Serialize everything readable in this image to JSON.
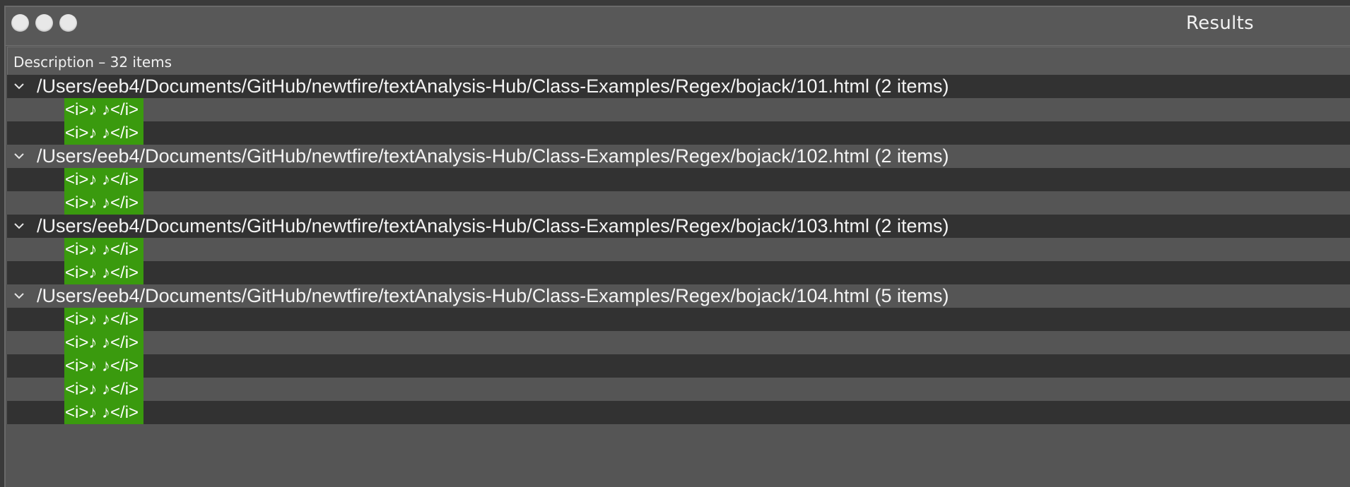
{
  "window": {
    "title": "Results"
  },
  "table": {
    "header": "Description – 32 items"
  },
  "groups": [
    {
      "path": "/Users/eeb4/Documents/GitHub/newtfire/textAnalysis-Hub/Class-Examples/Regex/bojack/101.html (2 items)",
      "matches": [
        "<i>♪ ♪</i>",
        "<i>♪ ♪</i>"
      ]
    },
    {
      "path": "/Users/eeb4/Documents/GitHub/newtfire/textAnalysis-Hub/Class-Examples/Regex/bojack/102.html (2 items)",
      "matches": [
        "<i>♪ ♪</i>",
        "<i>♪ ♪</i>"
      ]
    },
    {
      "path": "/Users/eeb4/Documents/GitHub/newtfire/textAnalysis-Hub/Class-Examples/Regex/bojack/103.html (2 items)",
      "matches": [
        "<i>♪ ♪</i>",
        "<i>♪ ♪</i>"
      ]
    },
    {
      "path": "/Users/eeb4/Documents/GitHub/newtfire/textAnalysis-Hub/Class-Examples/Regex/bojack/104.html (5 items)",
      "matches": [
        "<i>♪ ♪</i>",
        "<i>♪ ♪</i>",
        "<i>♪ ♪</i>",
        "<i>♪ ♪</i>",
        "<i>♪ ♪</i>"
      ]
    }
  ],
  "icons": {
    "expand": "chevron-down-icon"
  },
  "colors": {
    "match_highlight": "#3a9a0e",
    "row_dark": "#323232",
    "row_light": "#555555"
  }
}
